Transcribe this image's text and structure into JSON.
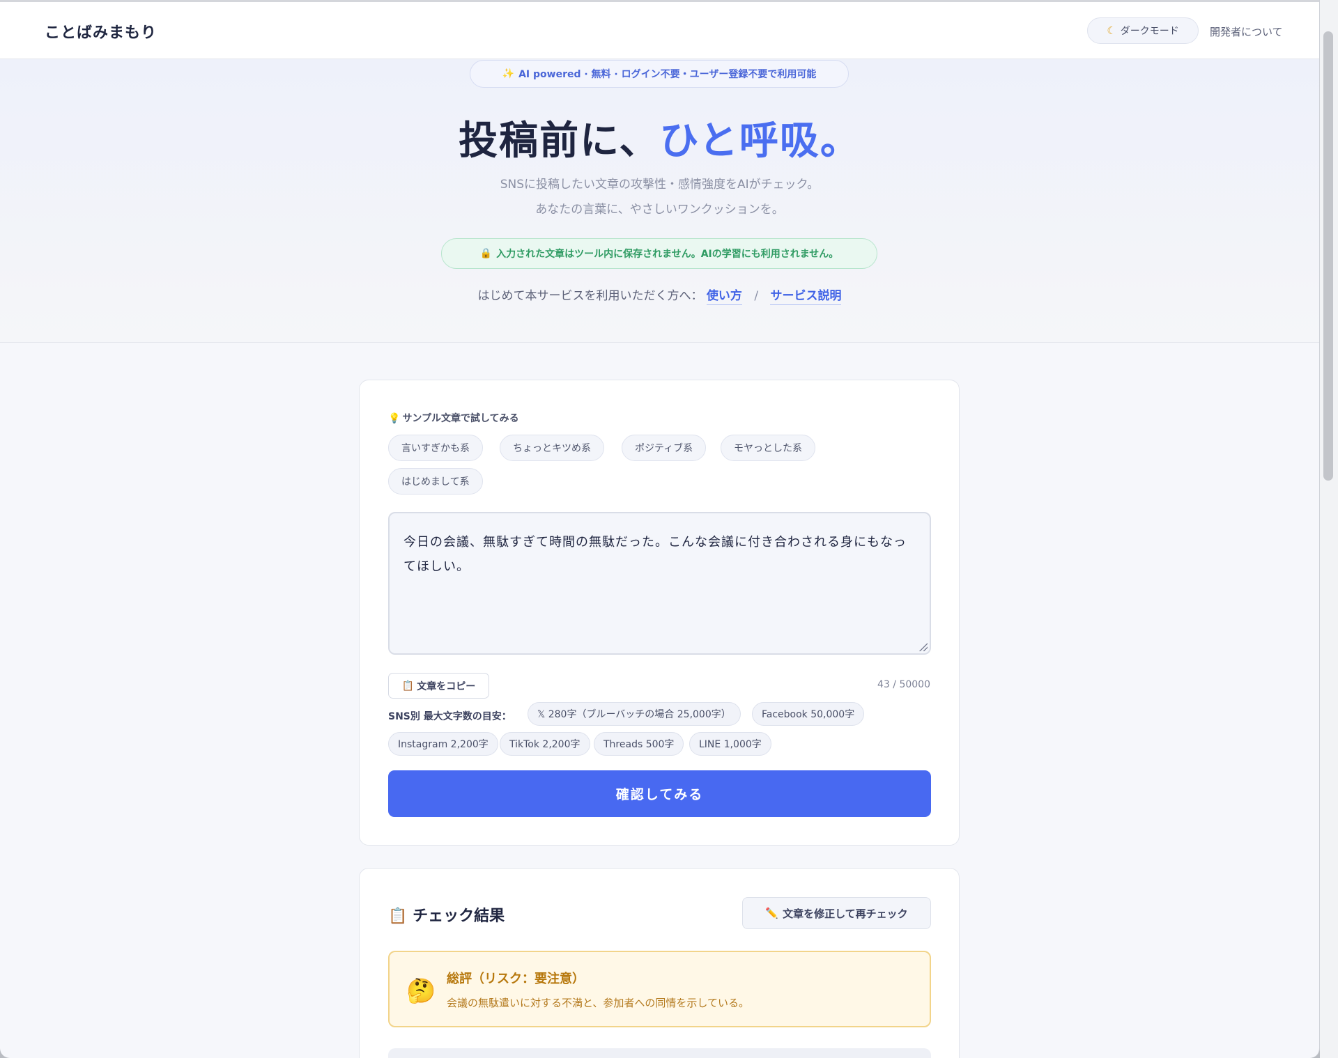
{
  "header": {
    "logo": "ことばみまもり",
    "dark_mode": {
      "icon": "moon-icon",
      "label": "ダークモード"
    },
    "developer_link": "開発者について"
  },
  "hero": {
    "badge": {
      "icon": "sparkles-icon",
      "text": "AI powered · 無料 · ログイン不要・ユーザー登録不要で利用可能"
    },
    "title_main": "投稿前に、",
    "title_accent": "ひと呼吸。",
    "subtitle_line1": "SNSに投稿したい文章の攻撃性・感情強度をAIがチェック。",
    "subtitle_line2": "あなたの言葉に、やさしいワンクッションを。",
    "privacy": {
      "icon": "lock-icon",
      "text": "入力された文章はツール内に保存されません。AIの学習にも利用されません。"
    },
    "guide_text": "はじめて本サービスを利用いただく方へ：",
    "guide_link_usage": "使い方",
    "guide_separator": "/",
    "guide_link_service": "サービス説明"
  },
  "input_card": {
    "sample_label": {
      "icon": "lightbulb-icon",
      "text": "サンプル文章で試してみる"
    },
    "samples": [
      "言いすぎかも系",
      "ちょっとキツめ系",
      "ポジティブ系",
      "モヤっとした系",
      "はじめまして系"
    ],
    "text_value": "今日の会議、無駄すぎて時間の無駄だった。こんな会議に付き合わされる身にもなってほしい。",
    "copy_button": {
      "icon": "clipboard-icon",
      "label": "文章をコピー"
    },
    "char_count": "43 / 50000",
    "sns_label": "SNS別 最大文字数の目安：",
    "sns_limits": [
      "𝕏 280字（ブルーバッチの場合 25,000字）",
      "Facebook 50,000字",
      "Instagram 2,200字",
      "TikTok 2,200字",
      "Threads 500字",
      "LINE 1,000字"
    ],
    "submit_label": "確認してみる"
  },
  "result_card": {
    "title": {
      "icon": "clipboard-icon",
      "text": "チェック結果"
    },
    "recheck_button": {
      "icon": "pencil-icon",
      "label": "文章を修正して再チェック"
    },
    "summary": {
      "icon": "thinking-face-icon",
      "heading": "総評（リスク：要注意）",
      "body": "会議の無駄遣いに対する不満と、参加者への同情を示している。"
    }
  },
  "colors": {
    "accent": "#4a6ef0",
    "button": "#4869f1",
    "privacy_green": "#2f9b63",
    "warning": "#b7780d"
  }
}
